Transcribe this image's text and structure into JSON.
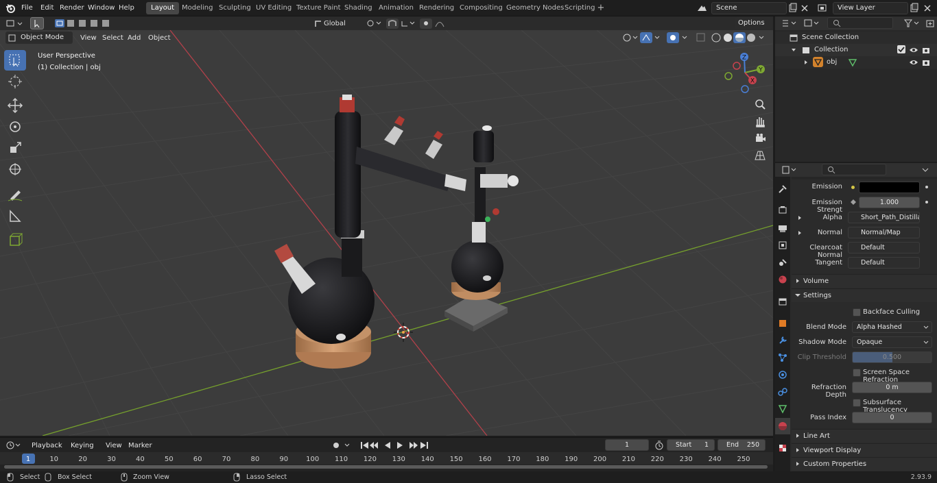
{
  "topbar": {
    "menus": [
      "File",
      "Edit",
      "Render",
      "Window",
      "Help"
    ],
    "workspaces": [
      "Layout",
      "Modeling",
      "Sculpting",
      "UV Editing",
      "Texture Paint",
      "Shading",
      "Animation",
      "Rendering",
      "Compositing",
      "Geometry Nodes",
      "Scripting"
    ],
    "active_workspace": "Layout",
    "scene": "Scene",
    "view_layer": "View Layer"
  },
  "viewport_header": {
    "mode": "Object Mode",
    "menus": [
      "View",
      "Select",
      "Add",
      "Object"
    ],
    "transform_orientation": "Global",
    "options": "Options"
  },
  "viewport": {
    "perspective_label": "User Perspective",
    "collection_label": "(1) Collection | obj",
    "gizmo_axes": [
      "X",
      "Y",
      "Z"
    ]
  },
  "outliner": {
    "root": "Scene Collection",
    "collection": "Collection",
    "object": "obj"
  },
  "properties": {
    "emission_label": "Emission",
    "emission_color": "#000000",
    "emission_strength_label": "Emission Strengt",
    "emission_strength": "1.000",
    "alpha_label": "Alpha",
    "alpha_value": "Short_Path_Distillati...",
    "normal_label": "Normal",
    "normal_value": "Normal/Map",
    "clearcoat_label": "Clearcoat Normal",
    "clearcoat_value": "Default",
    "tangent_label": "Tangent",
    "tangent_value": "Default",
    "volume_panel": "Volume",
    "settings_panel": "Settings",
    "backface_label": "Backface Culling",
    "blend_mode_label": "Blend Mode",
    "blend_mode": "Alpha Hashed",
    "shadow_mode_label": "Shadow Mode",
    "shadow_mode": "Opaque",
    "clip_label": "Clip Threshold",
    "clip_value": "0.500",
    "ssr_label": "Screen Space Refraction",
    "refraction_depth_label": "Refraction Depth",
    "refraction_depth": "0 m",
    "subsurface_label": "Subsurface Translucency",
    "pass_index_label": "Pass Index",
    "pass_index": "0",
    "lineart_panel": "Line Art",
    "viewport_display_panel": "Viewport Display",
    "custom_props_panel": "Custom Properties"
  },
  "timeline": {
    "menus": [
      "Playback",
      "Keying",
      "View",
      "Marker"
    ],
    "current_frame": "1",
    "start_label": "Start",
    "start": "1",
    "end_label": "End",
    "end": "250",
    "ruler": [
      "1",
      "10",
      "20",
      "30",
      "40",
      "50",
      "60",
      "70",
      "80",
      "90",
      "100",
      "110",
      "120",
      "130",
      "140",
      "150",
      "160",
      "170",
      "180",
      "190",
      "200",
      "210",
      "220",
      "230",
      "240",
      "250"
    ]
  },
  "statusbar": {
    "select": "Select",
    "box_select": "Box Select",
    "zoom_view": "Zoom View",
    "lasso_select": "Lasso Select",
    "version": "2.93.9"
  },
  "colors": {
    "accent": "#4772b3",
    "x_axis": "#c8424e",
    "y_axis": "#7ea832",
    "z_axis": "#4a7fd6",
    "viewport_bg": "#3c3c3c"
  }
}
